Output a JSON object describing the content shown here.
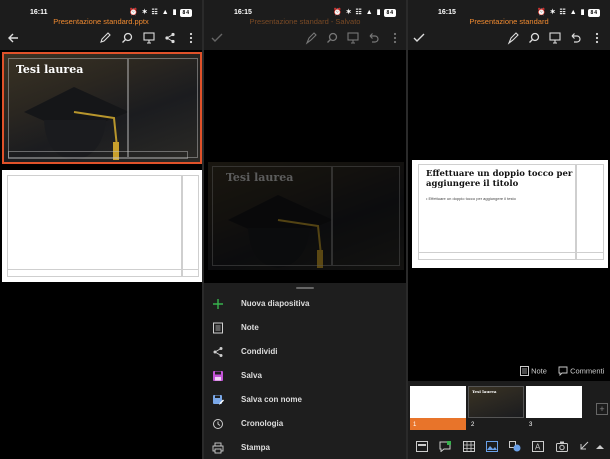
{
  "panel1": {
    "time": "16:11",
    "status_icons": "⏰ ✶ ☷ ▲ ▮",
    "battery": "84",
    "file_title": "Presentazione standard.pptx",
    "slide_title": "Tesi laurea"
  },
  "panel2": {
    "time": "16:15",
    "status_icons": "⏰ ✶ ☷ ▲ ▮",
    "battery": "84",
    "file_title": "Presentazione standard - Salvato",
    "slide_title": "Tesi laurea",
    "menu_items": [
      {
        "label": "Nuova diapositiva",
        "icon": "plus-icon",
        "color": "#37b24d"
      },
      {
        "label": "Note",
        "icon": "notes-icon",
        "color": "#cfcfcf"
      },
      {
        "label": "Condividi",
        "icon": "share-icon",
        "color": "#cfcfcf"
      },
      {
        "label": "Salva",
        "icon": "save-icon",
        "color": "#c455d8"
      },
      {
        "label": "Salva con nome",
        "icon": "save-as-icon",
        "color": "#7aa8e8"
      },
      {
        "label": "Cronologia",
        "icon": "history-icon",
        "color": "#cfcfcf"
      },
      {
        "label": "Stampa",
        "icon": "print-icon",
        "color": "#cfcfcf"
      }
    ]
  },
  "panel3": {
    "time": "16:15",
    "status_icons": "⏰ ✶ ☷ ▲ ▮",
    "battery": "84",
    "file_title": "Presentazione standard",
    "slide_title_placeholder": "Effettuare un doppio tocco per aggiungere il titolo",
    "slide_text_placeholder": "• Effettuare un doppio tocco per aggiungere il testo",
    "notes_label": "Note",
    "comments_label": "Commenti",
    "thumbs": [
      {
        "num": "1"
      },
      {
        "num": "2",
        "caption": "Tesi laurea"
      },
      {
        "num": "3"
      }
    ],
    "accent": "#e8742a"
  }
}
